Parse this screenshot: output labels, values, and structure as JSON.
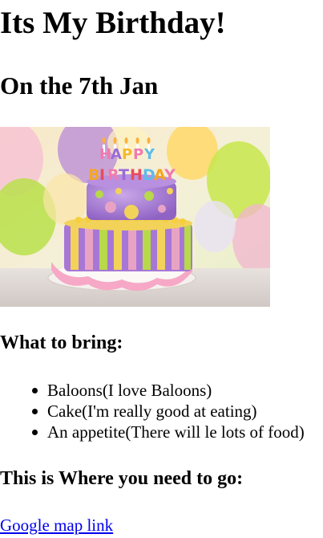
{
  "page": {
    "title": "Its My Birthday!",
    "subtitle": "On the 7th Jan"
  },
  "image": {
    "alt": "Birthday cake with Happy Birthday candles",
    "cake_letters_top": [
      "H",
      "A",
      "P",
      "P",
      "Y"
    ],
    "cake_letters_bottom": [
      "B",
      "I",
      "R",
      "T",
      "H",
      "D",
      "A",
      "Y"
    ]
  },
  "bring": {
    "heading": "What to bring:",
    "items": [
      "Baloons(I love Baloons)",
      "Cake(I'm really good at eating)",
      "An appetite(There will le lots of food)"
    ]
  },
  "location": {
    "heading": "This is Where you need to go:",
    "link_label": "Google map link"
  },
  "colors": {
    "link": "#0000ee",
    "text": "#000000",
    "background": "#ffffff"
  }
}
